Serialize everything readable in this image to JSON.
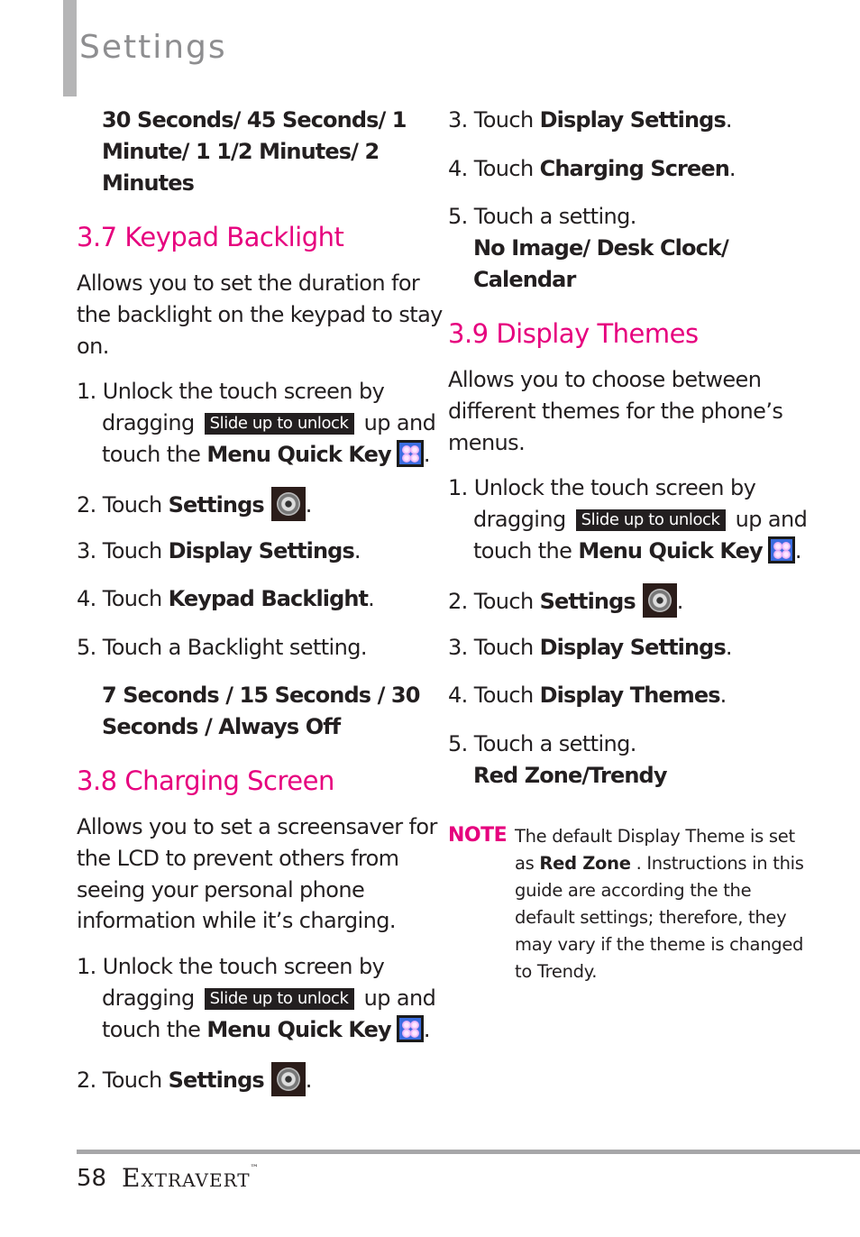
{
  "page": {
    "title": "Settings",
    "page_number": "58",
    "brand": "Extravert",
    "trademark": "™"
  },
  "intro_options": {
    "lines": [
      "30 Seconds/ 45 Seconds/ 1",
      "Minute/ 1 1/2 Minutes/ 2",
      "Minutes"
    ]
  },
  "section_37": {
    "heading": "3.7 Keypad Backlight",
    "description": [
      "Allows you to set the duration for",
      "the backlight on the keypad to stay",
      "on."
    ],
    "step1": {
      "num": "1.",
      "text_a": "Unlock the touch screen by",
      "text_b": "dragging",
      "pill": "Slide up to unlock",
      "text_c": "up and",
      "text_d": "touch the",
      "bold": "Menu Quick Key",
      "end": "."
    },
    "step2": {
      "num": "2.",
      "text": "Touch",
      "bold": "Settings",
      "end": "."
    },
    "step3": {
      "num": "3.",
      "text": "Touch",
      "bold": "Display Settings",
      "end": "."
    },
    "step4": {
      "num": "4.",
      "text": "Touch",
      "bold": "Keypad Backlight",
      "end": "."
    },
    "step5": {
      "num": "5.",
      "text": "Touch a Backlight setting."
    },
    "options": [
      "7 Seconds / 15 Seconds / 30",
      "Seconds / Always Off"
    ]
  },
  "section_38": {
    "heading": "3.8 Charging Screen",
    "description": [
      "Allows you to set a screensaver for",
      "the LCD to prevent others from",
      "seeing your personal phone",
      "information while it’s charging."
    ],
    "step1": {
      "num": "1.",
      "text_a": "Unlock the touch screen by",
      "text_b": "dragging",
      "pill": "Slide up to unlock",
      "text_c": "up and",
      "text_d": "touch the",
      "bold": "Menu Quick Key",
      "end": "."
    },
    "step2": {
      "num": "2.",
      "text": "Touch",
      "bold": "Settings",
      "end": "."
    },
    "step3": {
      "num": "3.",
      "text": "Touch",
      "bold": "Display Settings",
      "end": "."
    },
    "step4": {
      "num": "4.",
      "text": "Touch",
      "bold": "Charging Screen",
      "end": "."
    },
    "step5": {
      "num": "5.",
      "text": "Touch a setting."
    },
    "options": [
      "No Image/ Desk Clock/",
      "Calendar"
    ]
  },
  "section_39": {
    "heading": "3.9 Display Themes",
    "description": [
      "Allows you to choose between",
      "different themes for the phone’s",
      "menus."
    ],
    "step1": {
      "num": "1.",
      "text_a": "Unlock the touch screen by",
      "text_b": "dragging",
      "pill": "Slide up to unlock",
      "text_c": "up and",
      "text_d": "touch the",
      "bold": "Menu Quick Key",
      "end": "."
    },
    "step2": {
      "num": "2.",
      "text": "Touch",
      "bold": "Settings",
      "end": "."
    },
    "step3": {
      "num": "3.",
      "text": "Touch",
      "bold": "Display Settings",
      "end": "."
    },
    "step4": {
      "num": "4.",
      "text": "Touch",
      "bold": "Display Themes",
      "end": "."
    },
    "step5": {
      "num": "5.",
      "text": "Touch a setting."
    },
    "options": [
      "Red Zone/Trendy"
    ]
  },
  "note": {
    "label": "NOTE",
    "line1": "The default Display Theme is set",
    "line2_a": "as",
    "line2_bold": "Red Zone",
    "line2_b": ". Instructions in this",
    "line3": "guide are according the the",
    "line4": "default settings; therefore, they",
    "line5": "may vary if the theme is changed",
    "line6": "to Trendy."
  },
  "colors": {
    "accent": "#e6007e",
    "title_gray": "#8e8e90",
    "rule_gray": "#a7a7a9"
  }
}
